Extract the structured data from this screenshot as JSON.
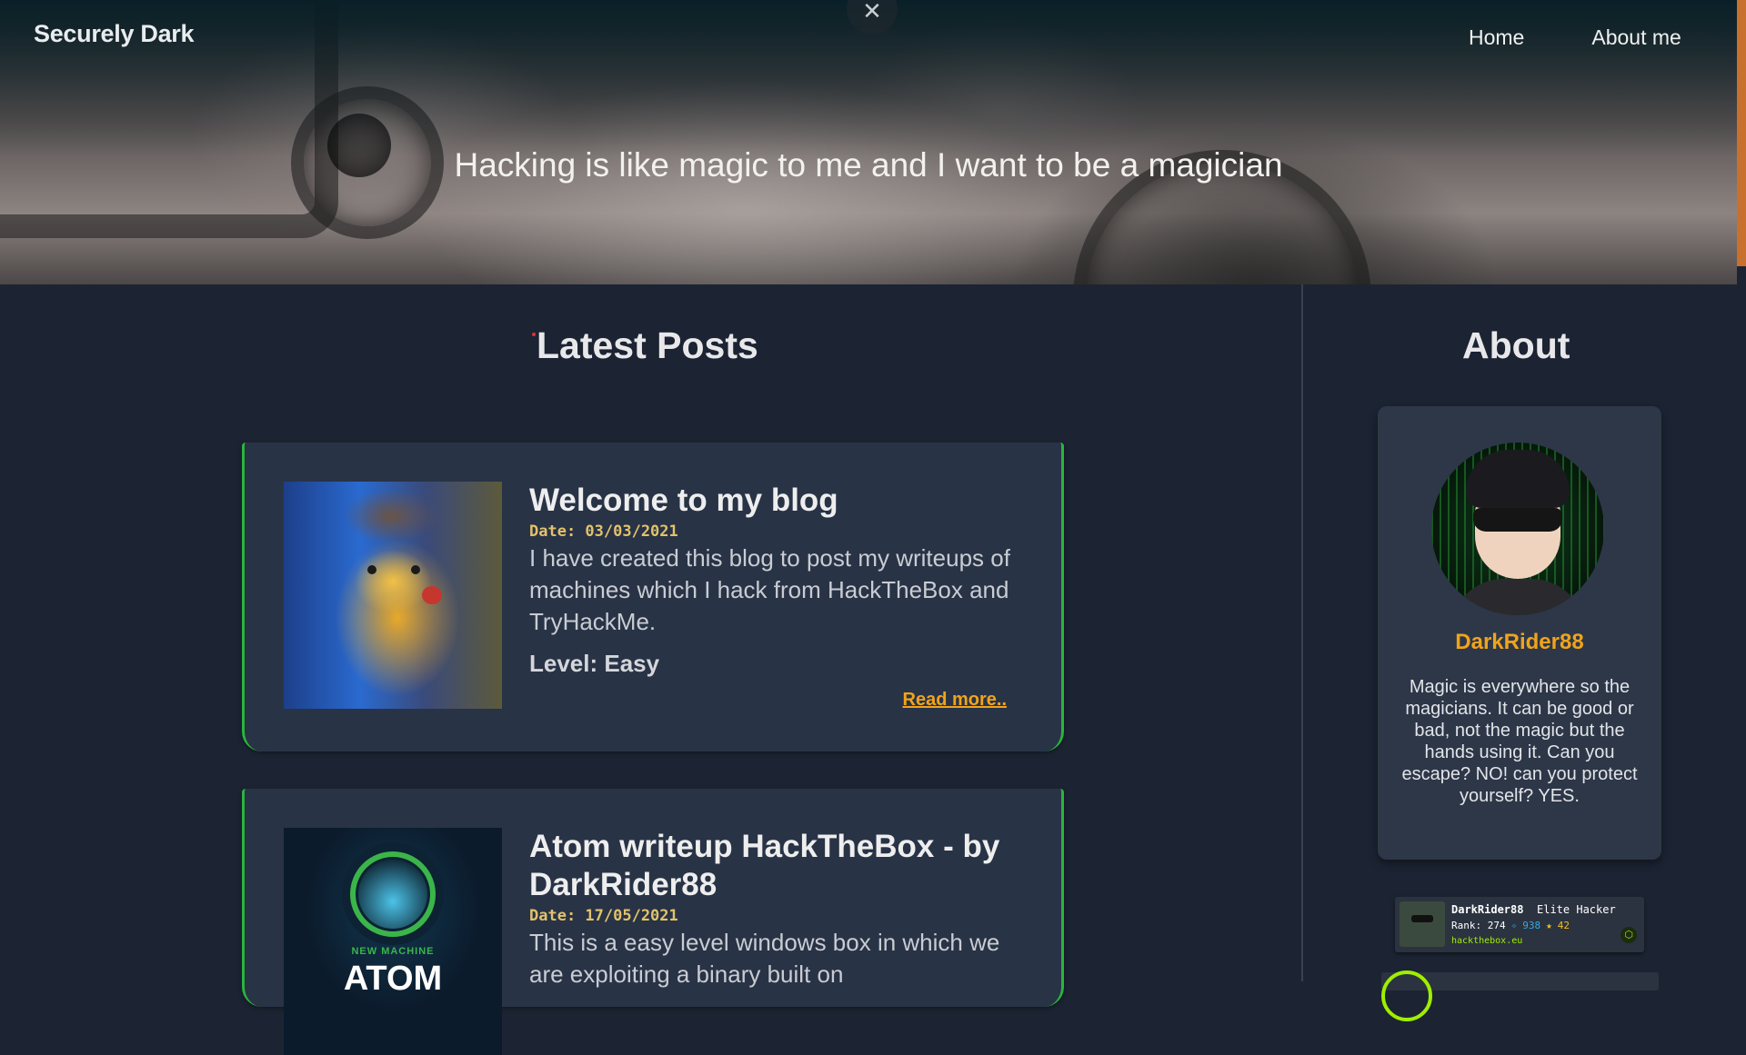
{
  "header": {
    "brand": "Securely Dark",
    "nav": [
      {
        "label": "Home"
      },
      {
        "label": "About me"
      }
    ],
    "close_icon": "close-icon",
    "tagline": "Hacking is like magic to me and I want to be a magician"
  },
  "main": {
    "section_title": "Latest Posts",
    "posts": [
      {
        "title": "Welcome to my blog",
        "date": "Date: 03/03/2021",
        "excerpt": "I have created this blog to post my writeups of machines which I hack from HackTheBox and TryHackMe.",
        "level": "Level: Easy",
        "read_more": "Read more.."
      },
      {
        "title": "Atom writeup HackTheBox - by DarkRider88",
        "date": "Date: 17/05/2021",
        "excerpt": "This is a easy level windows box in which we are exploiting a binary built on",
        "thumb_caption": "NEW MACHINE",
        "thumb_title": "ATOM"
      }
    ]
  },
  "sidebar": {
    "title": "About",
    "name": "DarkRider88",
    "bio": "Magic is everywhere so the magicians. It can be good or bad, not the magic but the hands using it. Can you escape? NO! can you protect yourself? YES.",
    "htb_badge": {
      "name": "DarkRider88",
      "title": "Elite Hacker",
      "rank": "Rank: 274",
      "points": "938",
      "respect": "42",
      "url": "hackthebox.eu"
    }
  },
  "colors": {
    "accent": "#f0a41b",
    "card_border": "#2bb43e",
    "background": "#1c2433",
    "card": "#283346"
  }
}
